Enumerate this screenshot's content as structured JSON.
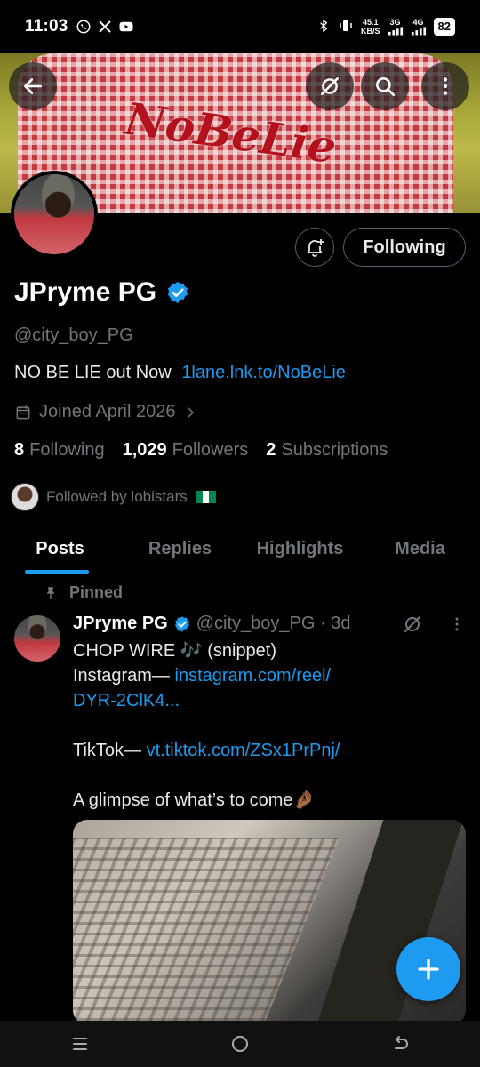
{
  "status_bar": {
    "time": "11:03",
    "speed_top": "45.1",
    "speed_bottom": "KB/S",
    "net1": "3G",
    "net2": "4G",
    "battery": "82"
  },
  "profile": {
    "name": "JPryme PG",
    "handle": "@city_boy_PG",
    "bio_text": "NO BE LIE out Now",
    "bio_link": "1lane.lnk.to/NoBeLie",
    "joined": "Joined April 2026",
    "following_count": "8",
    "following_label": "Following",
    "followers_count": "1,029",
    "followers_label": "Followers",
    "subscriptions_count": "2",
    "subscriptions_label": "Subscriptions",
    "followed_by": "Followed by lobistars",
    "follow_button": "Following",
    "banner_text": "NoBeLie"
  },
  "tabs": [
    {
      "label": "Posts",
      "active": true
    },
    {
      "label": "Replies",
      "active": false
    },
    {
      "label": "Highlights",
      "active": false
    },
    {
      "label": "Media",
      "active": false
    }
  ],
  "post": {
    "pinned_label": "Pinned",
    "name": "JPryme PG",
    "handle_time": "@city_boy_PG · 3d",
    "line1": "CHOP WIRE 🎶 (snippet)",
    "line2_text": "Instagram—",
    "line2_link": "instagram.com/reel/",
    "line3_link": "DYR-2ClK4...",
    "line4_text": "TikTok—",
    "line4_link": "vt.tiktok.com/ZSx1PrPnj/",
    "line5": "A glimpse of what’s to come🤌🏾"
  },
  "colors": {
    "accent": "#1d9bf0",
    "muted": "#71767b",
    "background": "#000000"
  }
}
